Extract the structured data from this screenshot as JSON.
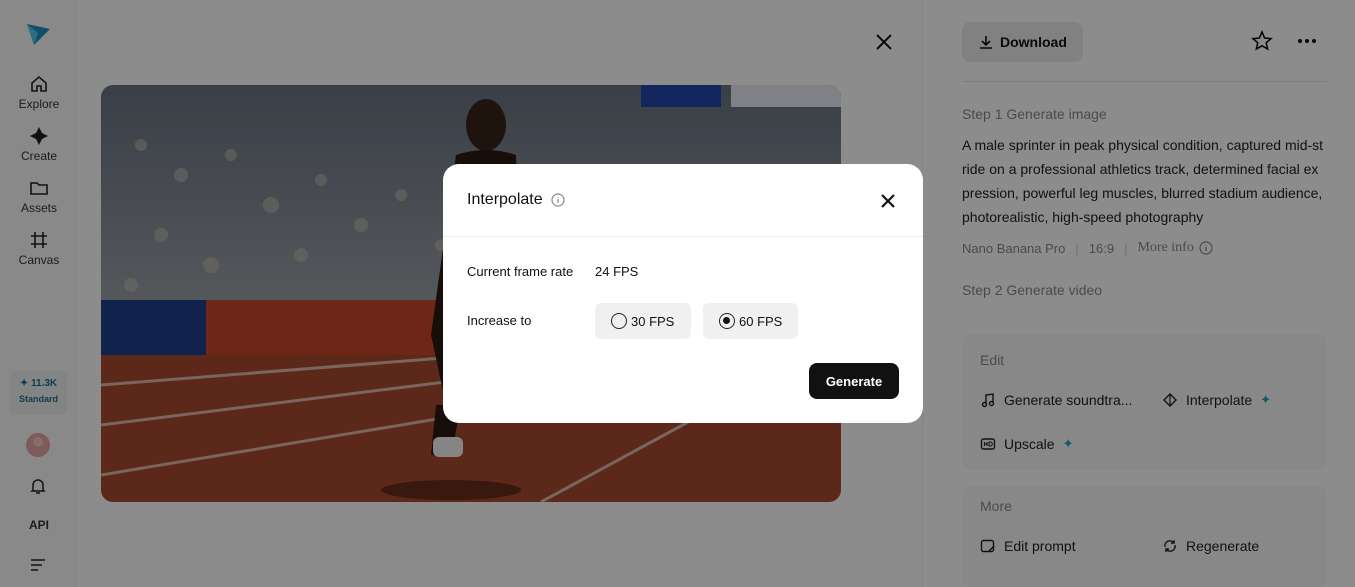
{
  "sidebar": {
    "items": [
      {
        "label": "Explore",
        "icon": "home-icon"
      },
      {
        "label": "Create",
        "icon": "sparkle-icon"
      },
      {
        "label": "Assets",
        "icon": "folder-icon"
      },
      {
        "label": "Canvas",
        "icon": "frame-icon"
      }
    ],
    "credits": {
      "amount": "✦ 11.3K",
      "plan": "Standard"
    },
    "api_label": "API"
  },
  "header": {
    "download_label": "Download"
  },
  "details": {
    "step1_label": "Step 1 Generate image",
    "prompt": "A male sprinter in peak physical condition, captured mid-stride on a professional athletics track, determined facial expression, powerful leg muscles, blurred stadium audience, photorealistic, high-speed photography",
    "model": "Nano Banana Pro",
    "ratio": "16:9",
    "more_info": "More info",
    "step2_label": "Step 2 Generate video"
  },
  "edit_card": {
    "title": "Edit",
    "actions": [
      {
        "label": "Generate soundtra...",
        "icon": "music-note-icon"
      },
      {
        "label": "Interpolate",
        "icon": "interpolate-icon",
        "badge": "✦"
      },
      {
        "label": "Upscale",
        "icon": "hd-icon",
        "badge": "✦"
      }
    ]
  },
  "more_card": {
    "title": "More",
    "actions": [
      {
        "label": "Edit prompt",
        "icon": "edit-prompt-icon"
      },
      {
        "label": "Regenerate",
        "icon": "regenerate-icon"
      }
    ]
  },
  "modal": {
    "title": "Interpolate",
    "current_rate_label": "Current frame rate",
    "current_rate_value": "24 FPS",
    "increase_label": "Increase to",
    "options": [
      {
        "label": "30 FPS",
        "selected": false
      },
      {
        "label": "60 FPS",
        "selected": true
      }
    ],
    "generate_label": "Generate"
  },
  "colors": {
    "accent": "#1aa3c2",
    "track": "#a84a2e",
    "banner": "#c8462a"
  }
}
